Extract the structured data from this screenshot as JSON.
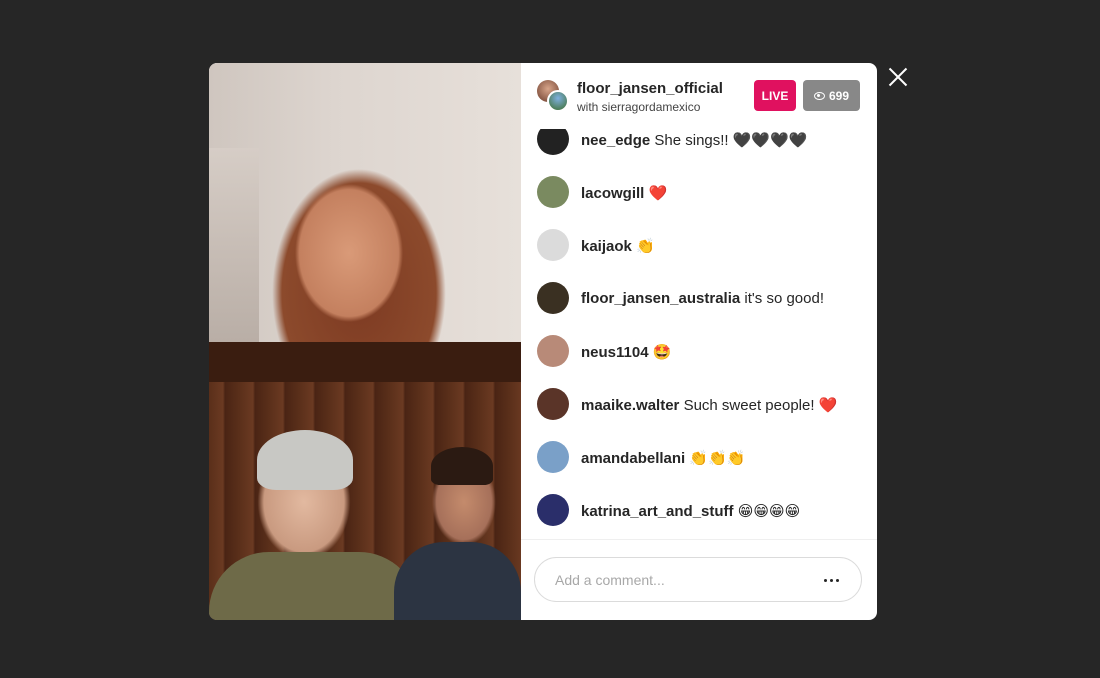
{
  "header": {
    "username": "floor_jansen_official",
    "with_text": "with sierragordamexico",
    "live_label": "LIVE",
    "viewer_count": "699",
    "viewer_icon": "eye-icon"
  },
  "comments": [
    {
      "user": "nee_edge",
      "message": "She sings!! 🖤🖤🖤🖤",
      "avatar_color": "#222222"
    },
    {
      "user": "lacowgill",
      "message": "❤️",
      "avatar_color": "#7a8a60"
    },
    {
      "user": "kaijaok",
      "message": "👏",
      "avatar_color": "#dbdbdb"
    },
    {
      "user": "floor_jansen_australia",
      "message": "it's so good!",
      "avatar_color": "#3a3022"
    },
    {
      "user": "neus1104",
      "message": "🤩",
      "avatar_color": "#b88a78"
    },
    {
      "user": "maaike.walter",
      "message": "Such sweet people! ❤️",
      "avatar_color": "#5a3428"
    },
    {
      "user": "amandabellani",
      "message": "👏👏👏",
      "avatar_color": "#7aa0c8"
    },
    {
      "user": "katrina_art_and_stuff",
      "message": "😁😁😁😁",
      "avatar_color": "#2a2e6a"
    }
  ],
  "comment_box": {
    "placeholder": "Add a comment...",
    "more_icon": "more-options-icon"
  },
  "close_icon": "close-icon",
  "colors": {
    "live": "#e0115f",
    "viewer_badge": "#888888",
    "backdrop": "#262626"
  }
}
